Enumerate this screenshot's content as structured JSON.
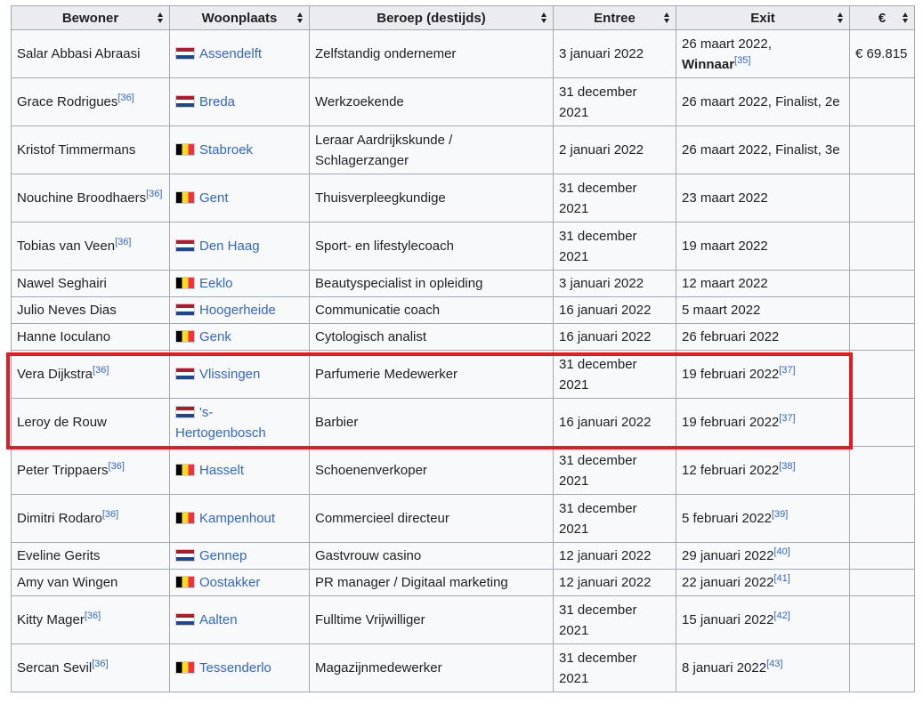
{
  "headers": [
    {
      "label": "Bewoner"
    },
    {
      "label": "Woonplaats"
    },
    {
      "label": "Beroep (destijds)"
    },
    {
      "label": "Entree"
    },
    {
      "label": "Exit"
    },
    {
      "label": "€"
    }
  ],
  "rows": [
    {
      "name": "Salar Abbasi Abraasi",
      "name_ref": "",
      "flag": "nl",
      "place": "Assendelft",
      "job": "Zelfstandig ondernemer",
      "entry": "3 januari 2022",
      "exit": "26 maart 2022,",
      "exit_bold": "Winnaar",
      "exit_ref": "[35]",
      "prize": "€ 69.815"
    },
    {
      "name": "Grace Rodrigues",
      "name_ref": "[36]",
      "flag": "nl",
      "place": "Breda",
      "job": "Werkzoekende",
      "entry": "31 december 2021",
      "exit": "26 maart 2022, Finalist, 2e",
      "exit_bold": "",
      "exit_ref": "",
      "prize": ""
    },
    {
      "name": "Kristof Timmermans",
      "name_ref": "",
      "flag": "be",
      "place": "Stabroek",
      "job": "Leraar Aardrijkskunde / Schlagerzanger",
      "entry": "2 januari 2022",
      "exit": "26 maart 2022, Finalist, 3e",
      "exit_bold": "",
      "exit_ref": "",
      "prize": ""
    },
    {
      "name": "Nouchine Broodhaers",
      "name_ref": "[36]",
      "flag": "be",
      "place": "Gent",
      "job": "Thuisverpleegkundige",
      "entry": "31 december 2021",
      "exit": "23 maart 2022",
      "exit_bold": "",
      "exit_ref": "",
      "prize": ""
    },
    {
      "name": "Tobias van Veen",
      "name_ref": "[36]",
      "flag": "nl",
      "place": "Den Haag",
      "job": "Sport- en lifestylecoach",
      "entry": "31 december 2021",
      "exit": "19 maart 2022",
      "exit_bold": "",
      "exit_ref": "",
      "prize": ""
    },
    {
      "name": "Nawel Seghairi",
      "name_ref": "",
      "flag": "be",
      "place": "Eeklo",
      "job": "Beautyspecialist in opleiding",
      "entry": "3 januari 2022",
      "exit": "12 maart 2022",
      "exit_bold": "",
      "exit_ref": "",
      "prize": ""
    },
    {
      "name": "Julio Neves Dias",
      "name_ref": "",
      "flag": "nl",
      "place": "Hoogerheide",
      "job": "Communicatie coach",
      "entry": "16 januari 2022",
      "exit": "5 maart 2022",
      "exit_bold": "",
      "exit_ref": "",
      "prize": ""
    },
    {
      "name": "Hanne Ioculano",
      "name_ref": "",
      "flag": "be",
      "place": "Genk",
      "job": "Cytologisch analist",
      "entry": "16 januari 2022",
      "exit": "26 februari 2022",
      "exit_bold": "",
      "exit_ref": "",
      "prize": ""
    },
    {
      "name": "Vera Dijkstra",
      "name_ref": "[36]",
      "flag": "nl",
      "place": "Vlissingen",
      "job": "Parfumerie Medewerker",
      "entry": "31 december 2021",
      "exit": "19 februari 2022",
      "exit_bold": "",
      "exit_ref": "[37]",
      "prize": ""
    },
    {
      "name": "Leroy de Rouw",
      "name_ref": "",
      "flag": "nl",
      "place": "'s-Hertogenbosch",
      "job": "Barbier",
      "entry": "16 januari 2022",
      "exit": "19 februari 2022",
      "exit_bold": "",
      "exit_ref": "[37]",
      "prize": ""
    },
    {
      "name": "Peter Trippaers",
      "name_ref": "[36]",
      "flag": "be",
      "place": "Hasselt",
      "job": "Schoenenverkoper",
      "entry": "31 december 2021",
      "exit": "12 februari 2022",
      "exit_bold": "",
      "exit_ref": "[38]",
      "prize": ""
    },
    {
      "name": "Dimitri Rodaro",
      "name_ref": "[36]",
      "flag": "be",
      "place": "Kampenhout",
      "job": "Commercieel directeur",
      "entry": "31 december 2021",
      "exit": "5 februari 2022",
      "exit_bold": "",
      "exit_ref": "[39]",
      "prize": ""
    },
    {
      "name": "Eveline Gerits",
      "name_ref": "",
      "flag": "nl",
      "place": "Gennep",
      "job": "Gastvrouw casino",
      "entry": "12 januari 2022",
      "exit": "29 januari 2022",
      "exit_bold": "",
      "exit_ref": "[40]",
      "prize": ""
    },
    {
      "name": "Amy van Wingen",
      "name_ref": "",
      "flag": "be",
      "place": "Oostakker",
      "job": "PR manager / Digitaal marketing",
      "entry": "12 januari 2022",
      "exit": "22 januari 2022",
      "exit_bold": "",
      "exit_ref": "[41]",
      "prize": ""
    },
    {
      "name": "Kitty Mager",
      "name_ref": "[36]",
      "flag": "nl",
      "place": "Aalten",
      "job": "Fulltime Vrijwilliger",
      "entry": "31 december 2021",
      "exit": "15 januari 2022",
      "exit_bold": "",
      "exit_ref": "[42]",
      "prize": ""
    },
    {
      "name": "Sercan Sevil",
      "name_ref": "[36]",
      "flag": "be",
      "place": "Tessenderlo",
      "job": "Magazijnmedewerker",
      "entry": "31 december 2021",
      "exit": "8 januari 2022",
      "exit_bold": "",
      "exit_ref": "[43]",
      "prize": ""
    }
  ],
  "colors": {
    "header_bg": "#eaecf0",
    "cell_bg": "#f8f9fa",
    "border": "#a2a9b1",
    "link": "#3366cc",
    "highlight": "#e31c23"
  }
}
